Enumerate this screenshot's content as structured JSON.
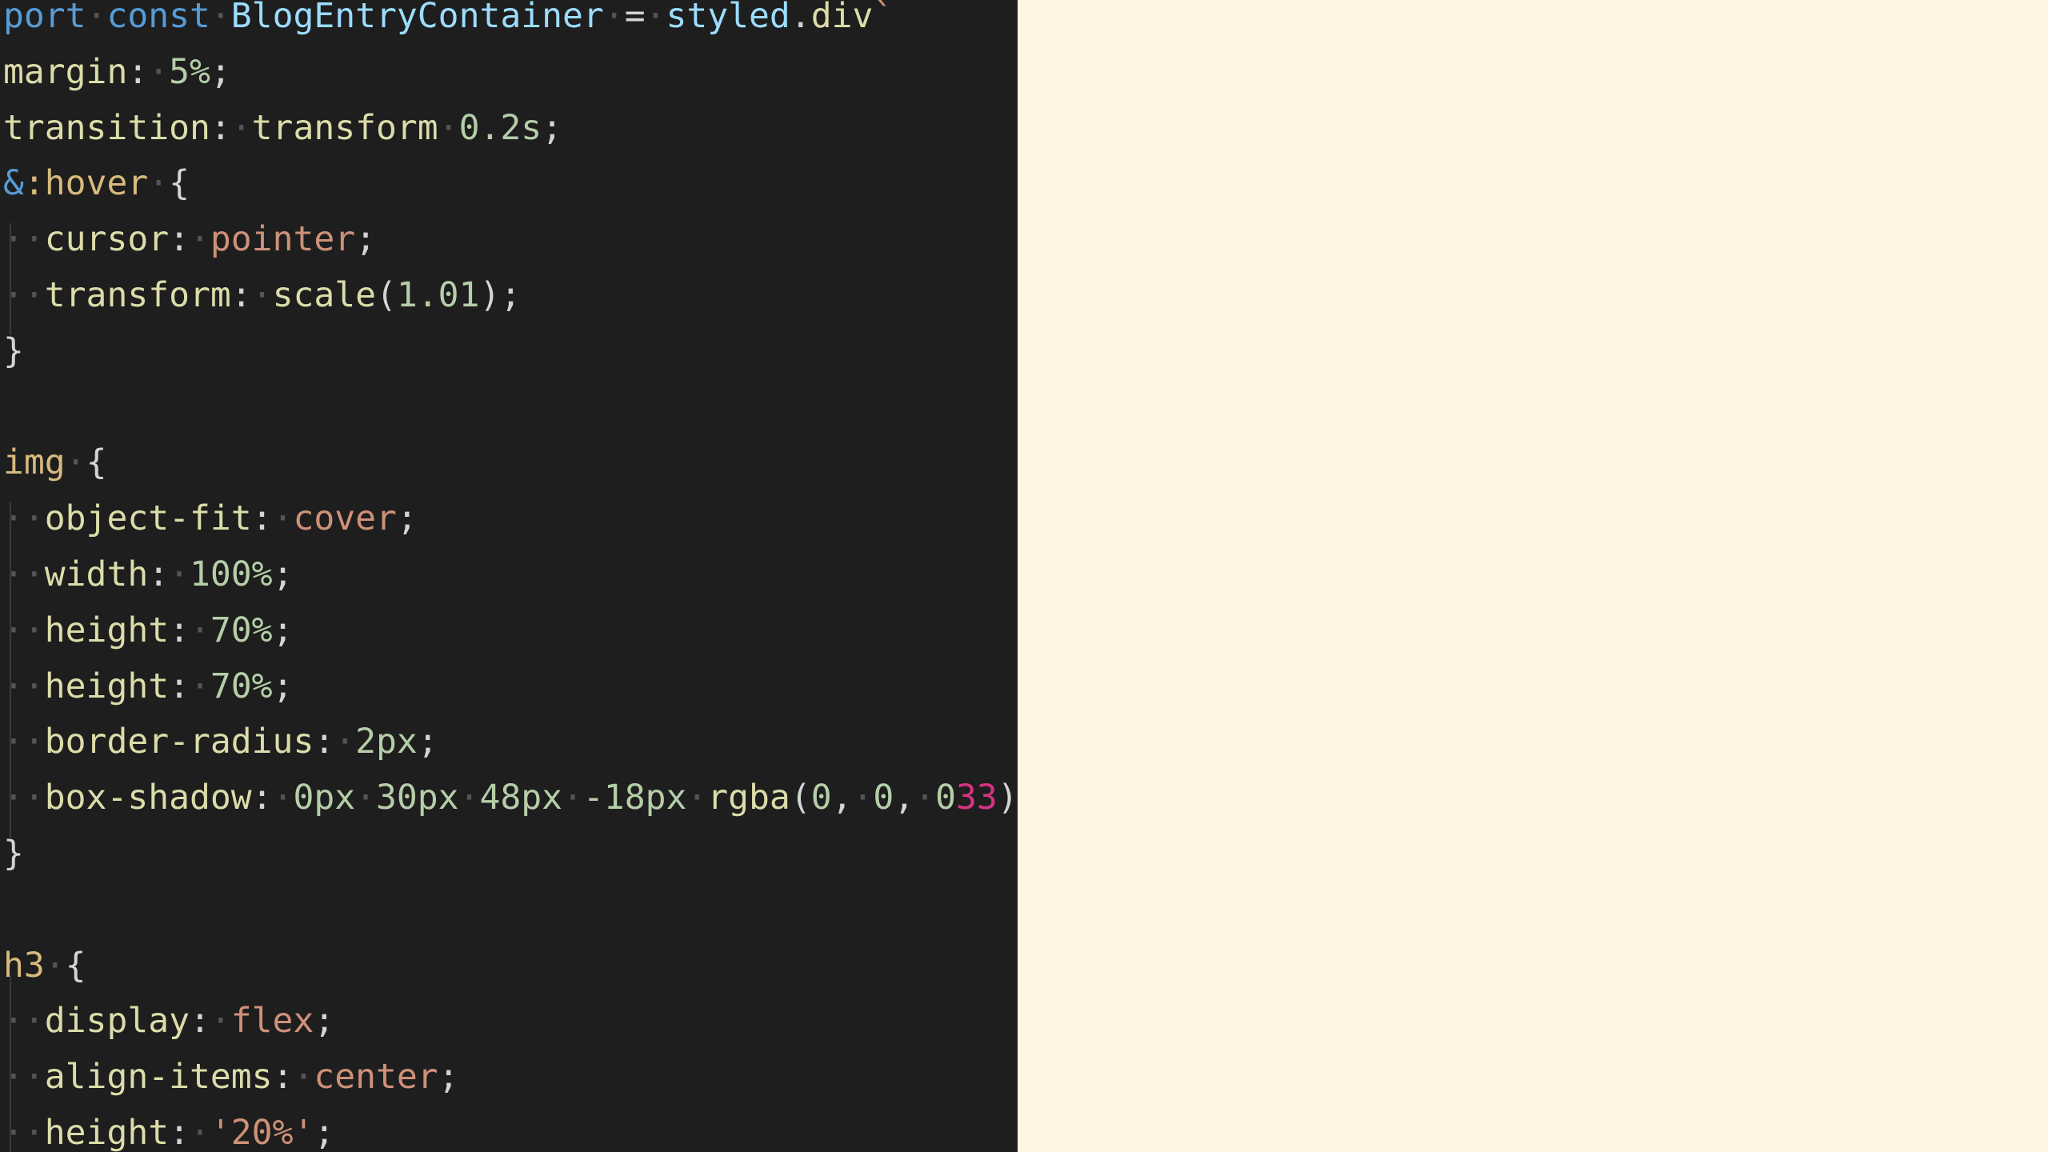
{
  "editor": {
    "lines": [
      {
        "tokens": [
          {
            "t": "port",
            "c": "tok-kw"
          },
          {
            "t": "·",
            "c": "ws-dot"
          },
          {
            "t": "const",
            "c": "tok-kw"
          },
          {
            "t": "·",
            "c": "ws-dot"
          },
          {
            "t": "BlogEntryContainer",
            "c": "tok-type"
          },
          {
            "t": "·",
            "c": "ws-dot"
          },
          {
            "t": "=",
            "c": "tok-plain"
          },
          {
            "t": "·",
            "c": "ws-dot"
          },
          {
            "t": "styled",
            "c": "tok-type"
          },
          {
            "t": ".",
            "c": "tok-plain"
          },
          {
            "t": "div",
            "c": "tok-fn"
          },
          {
            "t": "`",
            "c": "tok-val"
          }
        ]
      },
      {
        "tokens": [
          {
            "t": "margin",
            "c": "tok-prop"
          },
          {
            "t": ":",
            "c": "tok-plain"
          },
          {
            "t": "·",
            "c": "ws-dot"
          },
          {
            "t": "5%",
            "c": "tok-num"
          },
          {
            "t": ";",
            "c": "tok-plain"
          }
        ]
      },
      {
        "tokens": [
          {
            "t": "transition",
            "c": "tok-prop"
          },
          {
            "t": ":",
            "c": "tok-plain"
          },
          {
            "t": "·",
            "c": "ws-dot"
          },
          {
            "t": "transform",
            "c": "tok-prop"
          },
          {
            "t": "·",
            "c": "ws-dot"
          },
          {
            "t": "0.2s",
            "c": "tok-num"
          },
          {
            "t": ";",
            "c": "tok-plain"
          }
        ]
      },
      {
        "tokens": [
          {
            "t": "&",
            "c": "tok-amp"
          },
          {
            "t": ":hover",
            "c": "tok-sel"
          },
          {
            "t": "·",
            "c": "ws-dot"
          },
          {
            "t": "{",
            "c": "tok-brace"
          }
        ]
      },
      {
        "tokens": [
          {
            "t": "··",
            "c": "ws-dot"
          },
          {
            "t": "cursor",
            "c": "tok-prop"
          },
          {
            "t": ":",
            "c": "tok-plain"
          },
          {
            "t": "·",
            "c": "ws-dot"
          },
          {
            "t": "pointer",
            "c": "tok-val"
          },
          {
            "t": ";",
            "c": "tok-plain"
          }
        ]
      },
      {
        "tokens": [
          {
            "t": "··",
            "c": "ws-dot"
          },
          {
            "t": "transform",
            "c": "tok-prop"
          },
          {
            "t": ":",
            "c": "tok-plain"
          },
          {
            "t": "·",
            "c": "ws-dot"
          },
          {
            "t": "scale",
            "c": "tok-fn"
          },
          {
            "t": "(",
            "c": "tok-plain"
          },
          {
            "t": "1.01",
            "c": "tok-num"
          },
          {
            "t": ");",
            "c": "tok-plain"
          }
        ]
      },
      {
        "tokens": [
          {
            "t": "}",
            "c": "tok-brace"
          }
        ]
      },
      {
        "tokens": []
      },
      {
        "tokens": [
          {
            "t": "img",
            "c": "tok-sel"
          },
          {
            "t": "·",
            "c": "ws-dot"
          },
          {
            "t": "{",
            "c": "tok-brace"
          }
        ]
      },
      {
        "tokens": [
          {
            "t": "··",
            "c": "ws-dot"
          },
          {
            "t": "object-fit",
            "c": "tok-prop"
          },
          {
            "t": ":",
            "c": "tok-plain"
          },
          {
            "t": "·",
            "c": "ws-dot"
          },
          {
            "t": "cover",
            "c": "tok-val"
          },
          {
            "t": ";",
            "c": "tok-plain"
          }
        ]
      },
      {
        "tokens": [
          {
            "t": "··",
            "c": "ws-dot"
          },
          {
            "t": "width",
            "c": "tok-prop"
          },
          {
            "t": ":",
            "c": "tok-plain"
          },
          {
            "t": "·",
            "c": "ws-dot"
          },
          {
            "t": "100%",
            "c": "tok-num"
          },
          {
            "t": ";",
            "c": "tok-plain"
          }
        ]
      },
      {
        "tokens": [
          {
            "t": "··",
            "c": "ws-dot"
          },
          {
            "t": "height",
            "c": "tok-prop"
          },
          {
            "t": ":",
            "c": "tok-plain"
          },
          {
            "t": "·",
            "c": "ws-dot"
          },
          {
            "t": "70%",
            "c": "tok-num"
          },
          {
            "t": ";",
            "c": "tok-plain"
          }
        ]
      },
      {
        "tokens": [
          {
            "t": "··",
            "c": "ws-dot"
          },
          {
            "t": "height",
            "c": "tok-prop"
          },
          {
            "t": ":",
            "c": "tok-plain"
          },
          {
            "t": "·",
            "c": "ws-dot"
          },
          {
            "t": "70%",
            "c": "tok-num"
          },
          {
            "t": ";",
            "c": "tok-plain"
          }
        ]
      },
      {
        "tokens": [
          {
            "t": "··",
            "c": "ws-dot"
          },
          {
            "t": "border-radius",
            "c": "tok-prop"
          },
          {
            "t": ":",
            "c": "tok-plain"
          },
          {
            "t": "·",
            "c": "ws-dot"
          },
          {
            "t": "2px",
            "c": "tok-num"
          },
          {
            "t": ";",
            "c": "tok-plain"
          }
        ]
      },
      {
        "tokens": [
          {
            "t": "··",
            "c": "ws-dot"
          },
          {
            "t": "box-shadow",
            "c": "tok-prop"
          },
          {
            "t": ":",
            "c": "tok-plain"
          },
          {
            "t": "·",
            "c": "ws-dot"
          },
          {
            "t": "0px",
            "c": "tok-num"
          },
          {
            "t": "·",
            "c": "ws-dot"
          },
          {
            "t": "30px",
            "c": "tok-num"
          },
          {
            "t": "·",
            "c": "ws-dot"
          },
          {
            "t": "48px",
            "c": "tok-num"
          },
          {
            "t": "·",
            "c": "ws-dot"
          },
          {
            "t": "-18px",
            "c": "tok-num"
          },
          {
            "t": "·",
            "c": "ws-dot"
          },
          {
            "t": "rgba",
            "c": "tok-fn"
          },
          {
            "t": "(",
            "c": "tok-plain"
          },
          {
            "t": "0",
            "c": "tok-num"
          },
          {
            "t": ",",
            "c": "tok-plain"
          },
          {
            "t": "·",
            "c": "ws-dot"
          },
          {
            "t": "0",
            "c": "tok-num"
          },
          {
            "t": ",",
            "c": "tok-plain"
          },
          {
            "t": "·",
            "c": "ws-dot"
          },
          {
            "t": "0",
            "c": "tok-num"
          },
          {
            "t": "33",
            "c": "tok-over"
          },
          {
            "t": ");",
            "c": "tok-plain"
          }
        ]
      },
      {
        "tokens": [
          {
            "t": "}",
            "c": "tok-brace"
          }
        ]
      },
      {
        "tokens": []
      },
      {
        "tokens": [
          {
            "t": "h3",
            "c": "tok-sel"
          },
          {
            "t": "·",
            "c": "ws-dot"
          },
          {
            "t": "{",
            "c": "tok-brace"
          }
        ]
      },
      {
        "tokens": [
          {
            "t": "··",
            "c": "ws-dot"
          },
          {
            "t": "display",
            "c": "tok-prop"
          },
          {
            "t": ":",
            "c": "tok-plain"
          },
          {
            "t": "·",
            "c": "ws-dot"
          },
          {
            "t": "flex",
            "c": "tok-val"
          },
          {
            "t": ";",
            "c": "tok-plain"
          }
        ]
      },
      {
        "tokens": [
          {
            "t": "··",
            "c": "ws-dot"
          },
          {
            "t": "align-items",
            "c": "tok-prop"
          },
          {
            "t": ":",
            "c": "tok-plain"
          },
          {
            "t": "·",
            "c": "ws-dot"
          },
          {
            "t": "center",
            "c": "tok-val"
          },
          {
            "t": ";",
            "c": "tok-plain"
          }
        ]
      },
      {
        "tokens": [
          {
            "t": "··",
            "c": "ws-dot"
          },
          {
            "t": "height",
            "c": "tok-prop"
          },
          {
            "t": ":",
            "c": "tok-plain"
          },
          {
            "t": "·",
            "c": "ws-dot"
          },
          {
            "t": "'20%'",
            "c": "tok-str"
          },
          {
            "t": ";",
            "c": "tok-plain"
          }
        ]
      }
    ]
  },
  "colors": {
    "editor_background": "#1e1e1e",
    "right_pane_background": "#fdf5e2"
  }
}
